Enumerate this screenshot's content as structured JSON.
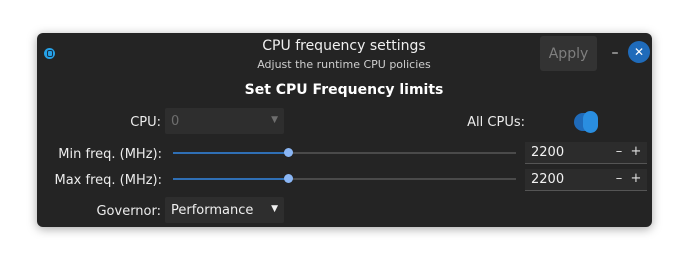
{
  "window": {
    "title": "CPU frequency settings",
    "subtitle": "Adjust the runtime CPU policies",
    "apply_label": "Apply",
    "minimize_label": "–",
    "close_label": "✕"
  },
  "section": {
    "title": "Set CPU Frequency limits"
  },
  "cpu": {
    "label": "CPU:",
    "value": "0",
    "enabled": false
  },
  "all_cpus": {
    "label": "All CPUs:",
    "on": true
  },
  "min_freq": {
    "label": "Min freq. (MHz):",
    "value": "2200",
    "slider_fraction": 0.335,
    "minus": "–",
    "plus": "+"
  },
  "max_freq": {
    "label": "Max freq. (MHz):",
    "value": "2200",
    "slider_fraction": 0.335,
    "minus": "–",
    "plus": "+"
  },
  "governor": {
    "label": "Governor:",
    "value": "Performance"
  },
  "colors": {
    "accent": "#1f6bba",
    "window_bg": "#242424",
    "slider_handle": "#8ab6f5"
  }
}
